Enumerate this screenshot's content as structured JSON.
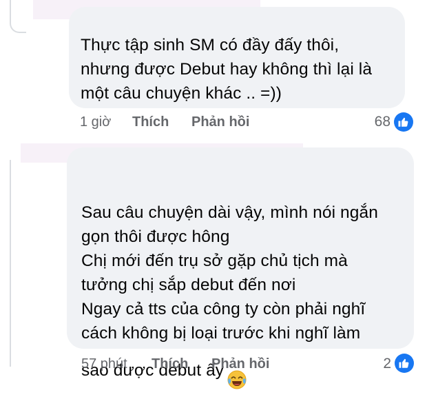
{
  "comments": [
    {
      "text": "Thực tập sinh SM có đầy đấy thôi,\nnhưng được Debut hay không thì lại là\nmột câu chuyện khác .. =))",
      "time": "1 giờ",
      "like_label": "Thích",
      "reply_label": "Phản hồi",
      "reaction_count": "68"
    },
    {
      "text": "Sau câu chuyện dài vậy, mình nói ngắn\ngọn thôi được hông\nChị mới đến trụ sở gặp chủ tịch mà\ntưởng chị sắp debut đến nơi\nNgay cả tts của công ty còn phải nghĩ\ncách không bị loại trước khi nghĩ làm\nsao được debut ấy",
      "time": "57 phút",
      "like_label": "Thích",
      "reply_label": "Phản hồi",
      "reaction_count": "2",
      "emoji": "face-with-tears-of-joy"
    }
  ],
  "colors": {
    "bubble": "#f0f2f5",
    "meta": "#65676b",
    "like_blue": "#1877f2",
    "redaction": "#f7f1f8"
  },
  "icons": {
    "reaction": "like-thumbs-up-icon"
  }
}
